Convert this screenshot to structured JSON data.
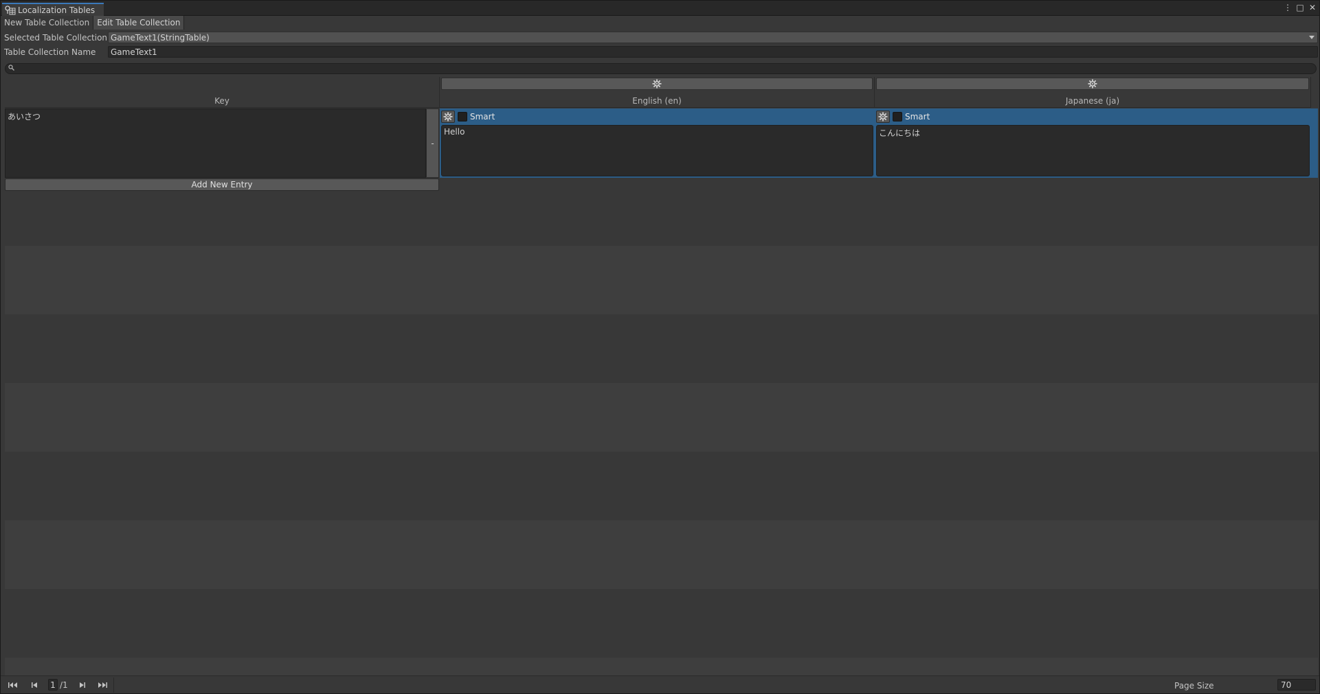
{
  "window": {
    "title": "Localization Tables",
    "controls": [
      "⋮",
      "□",
      "✕"
    ]
  },
  "tabs": [
    {
      "label": "New Table Collection",
      "active": false
    },
    {
      "label": "Edit Table Collection",
      "active": true
    }
  ],
  "fields": {
    "selected_collection_label": "Selected Table Collection",
    "selected_collection_value": "GameText1(StringTable)",
    "collection_name_label": "Table Collection Name",
    "collection_name_value": "GameText1"
  },
  "search": {
    "value": ""
  },
  "table": {
    "columns": [
      {
        "label": "Key"
      },
      {
        "label": "English (en)"
      },
      {
        "label": "Japanese (ja)"
      }
    ],
    "rows": [
      {
        "key": "あいさつ",
        "remove_label": "-",
        "cells": [
          {
            "smart_label": "Smart",
            "smart": false,
            "value": "Hello"
          },
          {
            "smart_label": "Smart",
            "smart": false,
            "value": "こんにちは"
          }
        ]
      }
    ],
    "add_entry_label": "Add New Entry"
  },
  "footer": {
    "current_page": "1",
    "total_pages": "/1",
    "page_size_label": "Page Size",
    "page_size_value": "70"
  },
  "colors": {
    "selected_row": "#2c5d87",
    "accent": "#3a79bb"
  }
}
